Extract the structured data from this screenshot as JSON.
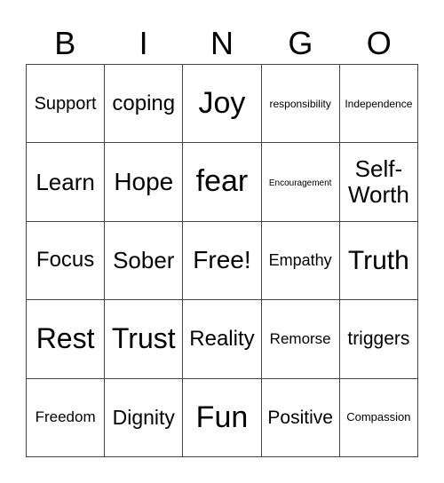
{
  "header": [
    "B",
    "I",
    "N",
    "G",
    "O"
  ],
  "cells": [
    [
      {
        "text": "Support",
        "size": 20
      },
      {
        "text": "coping",
        "size": 24
      },
      {
        "text": "Joy",
        "size": 34
      },
      {
        "text": "responsibility",
        "size": 12
      },
      {
        "text": "Independence",
        "size": 12
      }
    ],
    [
      {
        "text": "Learn",
        "size": 26
      },
      {
        "text": "Hope",
        "size": 28
      },
      {
        "text": "fear",
        "size": 34
      },
      {
        "text": "Encouragement",
        "size": 10
      },
      {
        "text": "Self-Worth",
        "size": 26
      }
    ],
    [
      {
        "text": "Focus",
        "size": 24
      },
      {
        "text": "Sober",
        "size": 26
      },
      {
        "text": "Free!",
        "size": 28
      },
      {
        "text": "Empathy",
        "size": 18
      },
      {
        "text": "Truth",
        "size": 30
      }
    ],
    [
      {
        "text": "Rest",
        "size": 32
      },
      {
        "text": "Trust",
        "size": 32
      },
      {
        "text": "Reality",
        "size": 24
      },
      {
        "text": "Remorse",
        "size": 17
      },
      {
        "text": "triggers",
        "size": 21
      }
    ],
    [
      {
        "text": "Freedom",
        "size": 17
      },
      {
        "text": "Dignity",
        "size": 23
      },
      {
        "text": "Fun",
        "size": 34
      },
      {
        "text": "Positive",
        "size": 21
      },
      {
        "text": "Compassion",
        "size": 13
      }
    ]
  ]
}
